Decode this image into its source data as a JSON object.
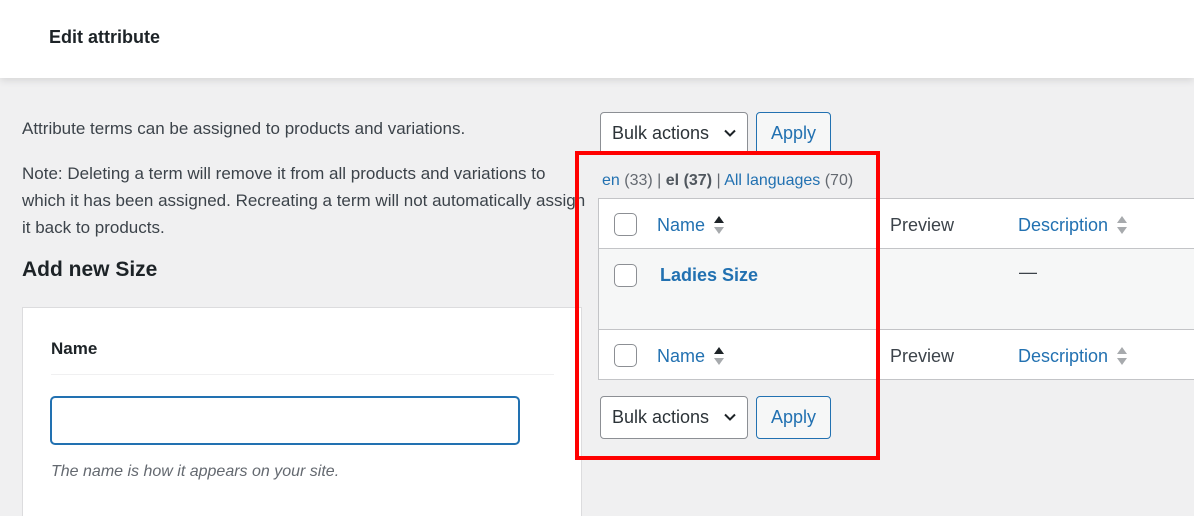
{
  "header": {
    "title": "Edit attribute"
  },
  "intro": {
    "line1": "Attribute terms can be assigned to products and variations.",
    "note": "Note: Deleting a term will remove it from all products and variations to which it has been assigned. Recreating a term will not automatically assign it back to products."
  },
  "add_new": {
    "title": "Add new Size",
    "name_label": "Name",
    "name_value": "",
    "name_placeholder": "",
    "help": "The name is how it appears on your site."
  },
  "toolbar": {
    "bulk_actions": "Bulk actions",
    "apply": "Apply"
  },
  "languages": [
    {
      "code": "en",
      "count": "(33)"
    },
    {
      "code": "el",
      "count": "(37)"
    },
    {
      "code": "All languages",
      "count": "(70)"
    }
  ],
  "table": {
    "columns": {
      "name": "Name",
      "preview": "Preview",
      "description": "Description"
    },
    "rows": [
      {
        "name": "Ladies Size",
        "preview": "",
        "description": "—"
      }
    ]
  },
  "colors": {
    "accent": "#2271b1",
    "highlight": "#ff0000"
  },
  "icons": [
    "chevron-down-icon",
    "sort-icon"
  ]
}
